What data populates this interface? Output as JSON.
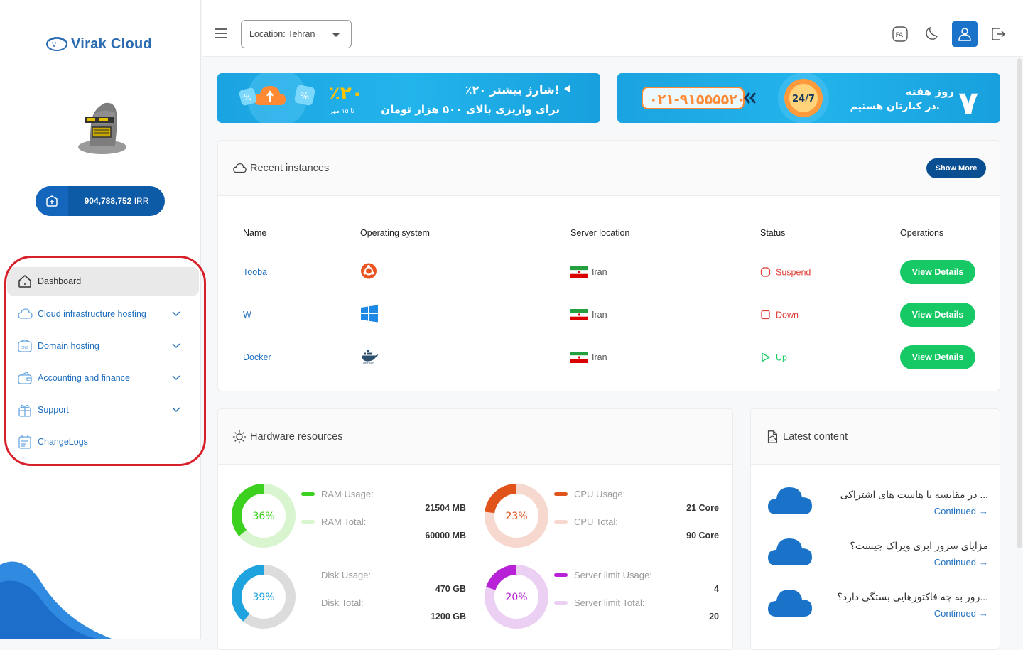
{
  "brand": {
    "name": "Virak Cloud"
  },
  "balance": {
    "amount": "904,788,752",
    "unit": "IRR"
  },
  "sidebar": {
    "items": [
      {
        "label": "Dashboard"
      },
      {
        "label": "Cloud infrastructure hosting"
      },
      {
        "label": "Domain hosting"
      },
      {
        "label": "Accounting and finance"
      },
      {
        "label": "Support"
      },
      {
        "label": "ChangeLogs"
      }
    ]
  },
  "topbar": {
    "location_label": "Location:",
    "location_value": "Tehran",
    "lang": "FA"
  },
  "banners": {
    "b1": {
      "percent": "٪۲۰",
      "line1": "٪۲۰ شارژ بیشتر!",
      "line2": "برای واریزی بالای ۵۰۰ هزار تومان",
      "date": "تا ۱۵ مهر"
    },
    "b2": {
      "phone": "۰۲۱-۹۱۵۵۵۵۲۰",
      "badge": "24/7",
      "line1": "روز هفته",
      "line2": "در کنارتان هستیم.",
      "seven": "۷"
    }
  },
  "recent": {
    "title": "Recent instances",
    "show_more": "Show More",
    "columns": [
      "Name",
      "Operating system",
      "Server location",
      "Status",
      "Operations"
    ],
    "rows": [
      {
        "name": "Tooba",
        "os_icon": "ubuntu-icon",
        "location": "Iran",
        "status": "Suspend",
        "status_color": "#e0413a",
        "action": "View Details"
      },
      {
        "name": "W",
        "os_icon": "windows-icon",
        "location": "Iran",
        "status": "Down",
        "status_color": "#e0413a",
        "action": "View Details"
      },
      {
        "name": "Docker",
        "os_icon": "docker-icon",
        "location": "Iran",
        "status": "Up",
        "status_color": "#17c964",
        "action": "View Details"
      }
    ]
  },
  "hardware": {
    "title": "Hardware resources",
    "ram": {
      "percent": "36%",
      "fraction": 0.36,
      "usage_label": "RAM Usage:",
      "total_label": "RAM Total:",
      "usage": "21504 MB",
      "total": "60000 MB",
      "color": "#3dd11f",
      "light": "#d8f5d0"
    },
    "cpu": {
      "percent": "23%",
      "fraction": 0.23,
      "usage_label": "CPU Usage:",
      "total_label": "CPU Total:",
      "usage": "21 Core",
      "total": "90 Core",
      "color": "#e0531a",
      "light": "#f7d8cf"
    },
    "disk": {
      "percent": "39%",
      "fraction": 0.39,
      "usage_label": "Disk Usage:",
      "total_label": "Disk Total:",
      "usage": "470 GB",
      "total": "1200 GB",
      "color": "#1ea3df",
      "light": "#dcdcdc"
    },
    "limit": {
      "percent": "20%",
      "fraction": 0.2,
      "usage_label": "Server limit Usage:",
      "total_label": "Server limit Total:",
      "usage": "4",
      "total": "20",
      "color": "#b722d6",
      "light": "#ecd0f4"
    }
  },
  "latest": {
    "title": "Latest content",
    "items": [
      {
        "title": "... در مقایسه با هاست های اشتراکی",
        "link": "Continued"
      },
      {
        "title": "مزایای سرور ابری ویراک چیست؟",
        "link": "Continued"
      },
      {
        "title": "...رور به چه فاکتورهایی بستگی دارد؟",
        "link": "Continued"
      }
    ]
  }
}
